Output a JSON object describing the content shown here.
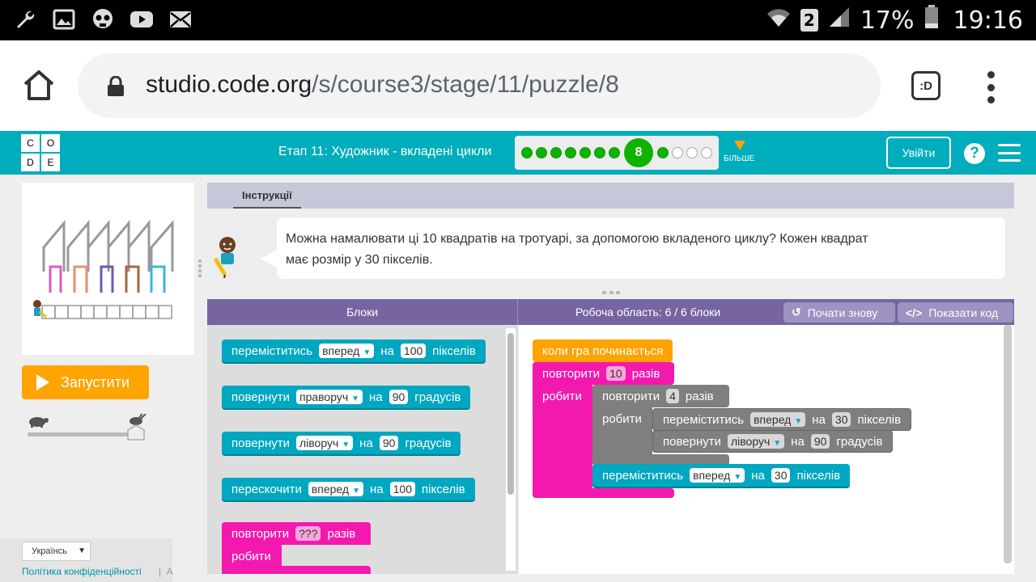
{
  "statusbar": {
    "battery_percent": "17%",
    "time": "19:16",
    "sim_slot": "2"
  },
  "browser": {
    "url_host": "studio.code.org",
    "url_path": "/s/course3/stage/11/puzzle/8",
    "tabs_label": ":D"
  },
  "header": {
    "logo_letters": [
      "C",
      "O",
      "D",
      "E"
    ],
    "stage_title": "Етап 11: Художник - вкладені цикли",
    "current_puzzle": "8",
    "more_label": "БІЛЬШЕ",
    "signin_label": "Увійти",
    "help_label": "?"
  },
  "left": {
    "run_label": "Запустити",
    "language": "Українсь",
    "privacy_link": "Політика конфіденційності",
    "separator": "|",
    "cut_text": "А"
  },
  "instructions": {
    "tab_label": "Інструкції",
    "text_line1": "Можна намалювати ці 10 квадратів на тротуарі, за допомогою вкладеного циклу? Кожен квадрат",
    "text_line2": "має розмір у 30 пікселів."
  },
  "workspace": {
    "toolbox_title": "Блоки",
    "workspace_title": "Робоча область: 6 / 6 блоки",
    "reset_label": "Почати знову",
    "show_code_label": "Показати код"
  },
  "toolbox_blocks": {
    "move": {
      "verb": "переміститись",
      "dir": "вперед",
      "on": "на",
      "value": "100",
      "unit": "пікселів"
    },
    "turn_right": {
      "verb": "повернути",
      "dir": "праворуч",
      "on": "на",
      "value": "90",
      "unit": "градусів"
    },
    "turn_left": {
      "verb": "повернути",
      "dir": "ліворуч",
      "on": "на",
      "value": "90",
      "unit": "градусів"
    },
    "jump": {
      "verb": "перескочити",
      "dir": "вперед",
      "on": "на",
      "value": "100",
      "unit": "пікселів"
    },
    "repeat": {
      "verb": "повторити",
      "value": "???",
      "unit": "разів",
      "do": "робити"
    }
  },
  "program": {
    "when_run": "коли гра починається",
    "outer_repeat": {
      "verb": "повторити",
      "value": "10",
      "unit": "разів",
      "do": "робити"
    },
    "inner_repeat": {
      "verb": "повторити",
      "value": "4",
      "unit": "разів",
      "do": "робити"
    },
    "inner_move": {
      "verb": "переміститись",
      "dir": "вперед",
      "on": "на",
      "value": "30",
      "unit": "пікселів"
    },
    "inner_turn": {
      "verb": "повернути",
      "dir": "ліворуч",
      "on": "на",
      "value": "90",
      "unit": "градусів"
    },
    "outer_move": {
      "verb": "переміститись",
      "dir": "вперед",
      "on": "на",
      "value": "30",
      "unit": "пікселів"
    }
  },
  "progress": {
    "completed_before": 7,
    "completed_after": 1,
    "remaining": 3
  },
  "colors": {
    "header_teal": "#00adbc",
    "workspace_purple": "#7665a0",
    "block_cyan": "#00a7c0",
    "block_pink": "#f319ae",
    "block_gray": "#7f7f7f",
    "block_orange": "#fea301",
    "run_orange": "#ffa400",
    "progress_green": "#0eb302"
  }
}
